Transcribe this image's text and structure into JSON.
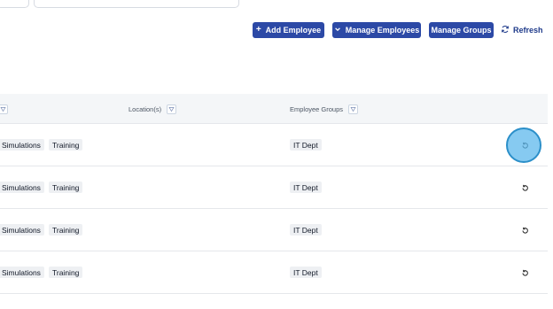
{
  "toolbar": {
    "add_employee": "Add Employee",
    "manage_employees": "Manage Employees",
    "manage_groups": "Manage Groups",
    "refresh": "Refresh"
  },
  "table": {
    "columns": [
      "Location(s)",
      "Employee Groups"
    ],
    "rows": [
      {
        "tags": [
          "Simulations",
          "Training"
        ],
        "group": "IT Dept"
      },
      {
        "tags": [
          "Simulations",
          "Training"
        ],
        "group": "IT Dept"
      },
      {
        "tags": [
          "Simulations",
          "Training"
        ],
        "group": "IT Dept"
      },
      {
        "tags": [
          "Simulations",
          "Training"
        ],
        "group": "IT Dept"
      }
    ]
  },
  "colors": {
    "primary_button": "#2c49a6",
    "header_background": "#f4f6f8",
    "chip_background": "#eef0f3",
    "cursor_highlight": "#5eb8ec"
  },
  "icons": {
    "add": "plus-icon",
    "manage": "chevron-down-icon",
    "refresh": "refresh-icon",
    "filter": "filter-icon",
    "row_action": "reset-icon"
  }
}
